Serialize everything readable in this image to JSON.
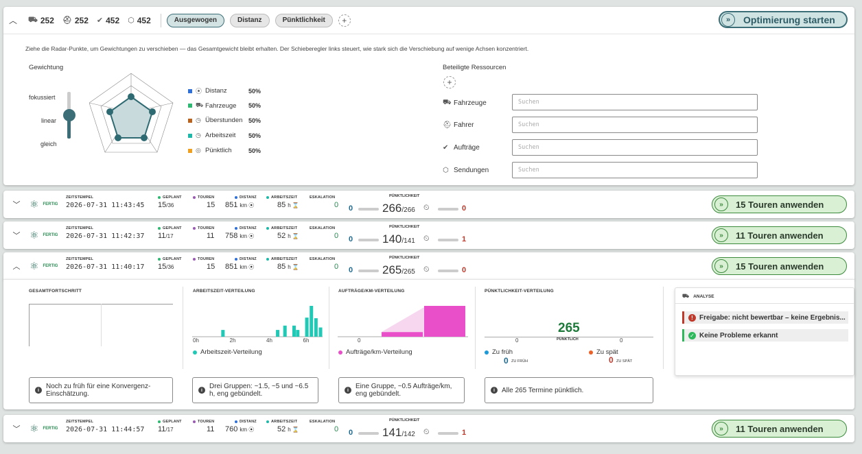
{
  "header": {
    "stats": [
      {
        "icon": "truck-icon",
        "glyph": "⛟",
        "value": "252"
      },
      {
        "icon": "driver-icon",
        "glyph": "⛑",
        "value": "252"
      },
      {
        "icon": "check-circle-icon",
        "glyph": "✔",
        "value": "452"
      },
      {
        "icon": "package-icon",
        "glyph": "⬡",
        "value": "452"
      }
    ],
    "pills": [
      {
        "label": "Ausgewogen",
        "active": true
      },
      {
        "label": "Distanz",
        "active": false
      },
      {
        "label": "Pünktlichkeit",
        "active": false
      }
    ],
    "add": "+",
    "optimize_label": "Optimierung starten"
  },
  "panel": {
    "hint": "Ziehe die Radar-Punkte, um Gewichtungen zu verschieben — das Gesamtgewicht bleibt erhalten. Der Schieberegler links steuert, wie stark sich die Verschiebung auf wenige Achsen konzentriert.",
    "weight_title": "Gewichtung",
    "slider_labels": [
      "fokussiert",
      "linear",
      "gleich"
    ],
    "slider_value": "linear",
    "weights": [
      {
        "name": "Distanz",
        "value": "50%",
        "color": "#2f6fd6",
        "glyph": "⦿"
      },
      {
        "name": "Fahrzeuge",
        "value": "50%",
        "color": "#2eb872",
        "glyph": "⛟"
      },
      {
        "name": "Überstunden",
        "value": "50%",
        "color": "#b8621f",
        "glyph": "◷"
      },
      {
        "name": "Arbeitszeit",
        "value": "50%",
        "color": "#1fb8a8",
        "glyph": "◷"
      },
      {
        "name": "Pünktlich",
        "value": "50%",
        "color": "#f0a020",
        "glyph": "◎"
      }
    ],
    "res_title": "Beteiligte Ressourcen",
    "res_add": "+",
    "resources": [
      {
        "name": "Fahrzeuge",
        "glyph": "⛟",
        "placeholder": "Suchen"
      },
      {
        "name": "Fahrer",
        "glyph": "⛑",
        "placeholder": "Suchen"
      },
      {
        "name": "Aufträge",
        "glyph": "✔",
        "placeholder": "Suchen"
      },
      {
        "name": "Sendungen",
        "glyph": "⬡",
        "placeholder": "Suchen"
      }
    ]
  },
  "labels": {
    "status": "FERTIG",
    "zeitstempel": "ZEITSTEMPEL",
    "geplant": "GEPLANT",
    "touren": "TOUREN",
    "distanz": "DISTANZ",
    "arbeitszeit": "ARBEITSZEIT",
    "eskalation": "ESKALATION",
    "puenktlichkeit": "PÜNKTLICHKEIT",
    "km": "km",
    "h": "h"
  },
  "runs": [
    {
      "ts": "2026-07-31 11:43:45",
      "geplant": "15",
      "geplant_of": "/36",
      "touren": "15",
      "distanz": "851",
      "arbeitszeit": "85",
      "eskalation": "0",
      "left": "0",
      "p": "266",
      "p_of": "/266",
      "right": "0",
      "apply": "15 Touren anwenden",
      "expanded": false
    },
    {
      "ts": "2026-07-31 11:42:37",
      "geplant": "11",
      "geplant_of": "/17",
      "touren": "11",
      "distanz": "758",
      "arbeitszeit": "52",
      "eskalation": "0",
      "left": "0",
      "p": "140",
      "p_of": "/141",
      "right": "1",
      "apply": "11 Touren anwenden",
      "expanded": false
    },
    {
      "ts": "2026-07-31 11:40:17",
      "geplant": "15",
      "geplant_of": "/36",
      "touren": "15",
      "distanz": "851",
      "arbeitszeit": "85",
      "eskalation": "0",
      "left": "0",
      "p": "265",
      "p_of": "/265",
      "right": "0",
      "apply": "15 Touren anwenden",
      "expanded": true
    },
    {
      "ts": "2026-07-31 11:44:57",
      "geplant": "11",
      "geplant_of": "/17",
      "touren": "11",
      "distanz": "760",
      "arbeitszeit": "52",
      "eskalation": "0",
      "left": "0",
      "p": "141",
      "p_of": "/142",
      "right": "1",
      "apply": "11 Touren anwenden",
      "expanded": false
    }
  ],
  "details": {
    "gesamt_title": "GESAMTFORTSCHRITT",
    "az_title": "ARBEITSZEIT-VERTEILUNG",
    "ak_title": "AUFTRÄGE/KM-VERTEILUNG",
    "pk_title": "PÜNKTLICHKEIT-VERTEILUNG",
    "az_ticks": [
      "0h",
      "2h",
      "4h",
      "6h"
    ],
    "az_legend": "Arbeitszeit-Verteilung",
    "ak_tick": "0",
    "ak_legend": "Aufträge/km-Verteilung",
    "pk_ticks": [
      "0",
      "0"
    ],
    "pk_value": "265",
    "pk_sub": "PÜNKTLICH",
    "zu_frueh": "Zu früh",
    "zu_frueh_val": "0",
    "zu_frueh_sub": "ZU FRÜH",
    "zu_spaet": "Zu spät",
    "zu_spaet_val": "0",
    "zu_spaet_sub": "ZU SPÄT",
    "notes": [
      "Noch zu früh für eine Konvergenz-Einschätzung.",
      "Drei Gruppen: ~1.5, ~5 und ~6.5 h, eng gebündelt.",
      "Eine Gruppe, ~0.5 Aufträge/km, eng gebündelt.",
      "Alle 265 Termine pünktlich."
    ],
    "analyse_title": "ANALYSE",
    "alerts": [
      {
        "text": "Freigabe: nicht bewertbar – keine Ergebnis...",
        "level": "error"
      },
      {
        "text": "Keine Probleme erkannt",
        "level": "ok"
      }
    ]
  },
  "chart_data": [
    {
      "type": "bar",
      "title": "ARBEITSZEIT-VERTEILUNG",
      "xlabel": "",
      "ylabel": "",
      "x_ticks": [
        "0h",
        "2h",
        "4h",
        "6h"
      ],
      "xlim": [
        0,
        7
      ],
      "bins": [
        {
          "x": 1.5,
          "v": 0.22
        },
        {
          "x": 4.5,
          "v": 0.22
        },
        {
          "x": 4.9,
          "v": 0.36
        },
        {
          "x": 5.4,
          "v": 0.36
        },
        {
          "x": 5.6,
          "v": 0.22
        },
        {
          "x": 6.1,
          "v": 0.62
        },
        {
          "x": 6.35,
          "v": 1.0
        },
        {
          "x": 6.6,
          "v": 0.6
        },
        {
          "x": 6.85,
          "v": 0.3
        }
      ],
      "series": [
        {
          "name": "Arbeitszeit-Verteilung",
          "color": "#20c9b5"
        }
      ]
    },
    {
      "type": "area",
      "title": "AUFTRÄGE/KM-VERTEILUNG",
      "x_ticks": [
        "0"
      ],
      "bins": [
        {
          "x": 0.45,
          "v": 0.15
        },
        {
          "x": 0.55,
          "v": 1.0
        }
      ],
      "series": [
        {
          "name": "Aufträge/km-Verteilung",
          "color": "#e84fc9"
        }
      ]
    }
  ]
}
